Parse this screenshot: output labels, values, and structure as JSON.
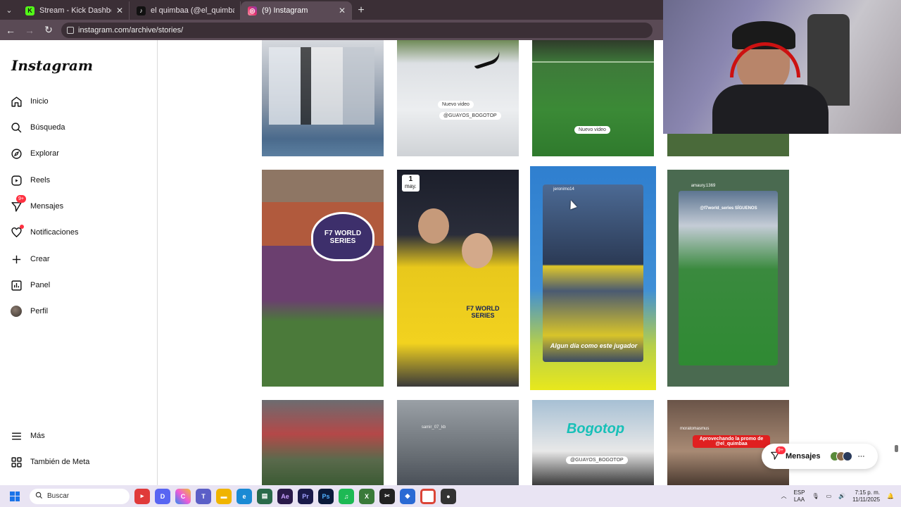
{
  "browser": {
    "tabs": [
      {
        "title": "Stream - Kick Dashboard",
        "favicon": "kick-icon",
        "color": "#53fc18",
        "active": false
      },
      {
        "title": "el quimbaa (@el_quimbaa) |",
        "favicon": "tiktok-icon",
        "color": "#111111",
        "active": false
      },
      {
        "title": "(9) Instagram",
        "favicon": "instagram-icon",
        "color": "#e1306c",
        "active": true
      }
    ],
    "url": "instagram.com/archive/stories/"
  },
  "sidebar": {
    "logo": "Instagram",
    "items": [
      {
        "label": "Inicio",
        "icon": "home-icon"
      },
      {
        "label": "Búsqueda",
        "icon": "search-icon"
      },
      {
        "label": "Explorar",
        "icon": "compass-icon"
      },
      {
        "label": "Reels",
        "icon": "reels-icon"
      },
      {
        "label": "Mensajes",
        "icon": "messenger-icon",
        "badge": "9+"
      },
      {
        "label": "Notificaciones",
        "icon": "heart-icon",
        "dot": true
      },
      {
        "label": "Crear",
        "icon": "plus-icon"
      },
      {
        "label": "Panel",
        "icon": "chart-icon"
      },
      {
        "label": "Perfil",
        "icon": "avatar"
      }
    ],
    "bottom": [
      {
        "label": "Más",
        "icon": "menu-icon"
      },
      {
        "label": "También de Meta",
        "icon": "meta-icon"
      }
    ]
  },
  "stories": {
    "row1": [
      {
        "sticker": ""
      },
      {
        "sticker": "Nuevo video",
        "sticker2": "@GUAYOS_BOGOTOP"
      },
      {
        "sticker": "Nuevo video"
      },
      {
        "sticker": ""
      }
    ],
    "row2": [
      {
        "text": "F7 WORLD SERIES"
      },
      {
        "date_day": "1",
        "date_month": "may.",
        "text": "F7 WORLD SERIES"
      },
      {
        "text": "Algun día como este jugador",
        "handle": "jeronimo14"
      },
      {
        "handle": "amaury.1369",
        "text": "@f7world_series SÍGUENOS"
      }
    ],
    "row3": [
      {
        "text": ""
      },
      {
        "handle": "samir_07_kb"
      },
      {
        "text": "Bogotop",
        "sticker": "@GUAYOS_BOGOTOP"
      },
      {
        "handle": "moratomasmus",
        "text": "Aprovechando la promo de @el_quimbaa"
      }
    ]
  },
  "messages_panel": {
    "label": "Mensajes",
    "badge": "9+"
  },
  "taskbar": {
    "search_placeholder": "Buscar",
    "lang_top": "ESP",
    "lang_bottom": "LAA",
    "time": "7:15 p. m.",
    "date": "11/11/2025"
  },
  "colors": {
    "accent": "#ff3040",
    "chrome": "#5a4a55"
  }
}
